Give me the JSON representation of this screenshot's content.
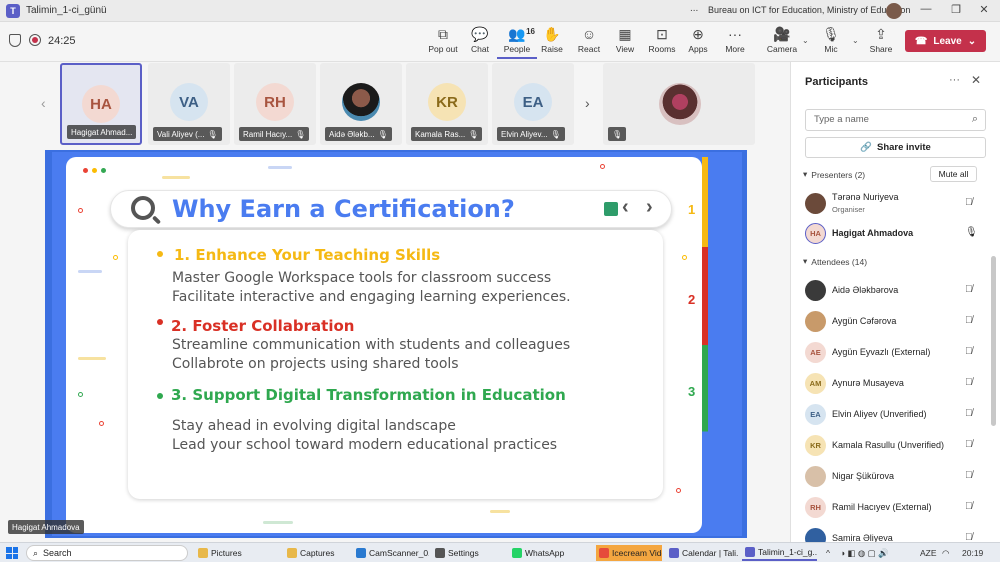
{
  "window": {
    "title": "Talimin_1-ci_günü",
    "more": "...",
    "org": "Bureau on ICT for Education, Ministry of Education",
    "controls": [
      "—",
      "❐",
      "✕"
    ]
  },
  "toolbar": {
    "timer": "24:25",
    "buttons": [
      {
        "label": "Pop out",
        "icon": "⧉"
      },
      {
        "label": "Chat",
        "icon": "💬"
      },
      {
        "label": "People",
        "icon": "👥",
        "count": "16"
      },
      {
        "label": "Raise",
        "icon": "✋"
      },
      {
        "label": "React",
        "icon": "☺"
      },
      {
        "label": "View",
        "icon": "▦"
      },
      {
        "label": "Rooms",
        "icon": "⊡"
      },
      {
        "label": "Apps",
        "icon": "⊕"
      },
      {
        "label": "More",
        "icon": "···"
      },
      {
        "label": "Camera",
        "icon": "🎥"
      },
      {
        "label": "Mic",
        "icon": "🎙"
      },
      {
        "label": "Share",
        "icon": "⇪"
      }
    ],
    "leave_label": "Leave",
    "leave_icon": "☎"
  },
  "tiles": [
    {
      "initials": "HA",
      "name": "Hagigat Ahmad...",
      "bg": "#f3d9d2",
      "fg": "#a8543f"
    },
    {
      "initials": "VA",
      "name": "Vali Aliyev (...",
      "bg": "#d6e4f0",
      "fg": "#3d5f85"
    },
    {
      "initials": "RH",
      "name": "Ramil Hacıy...",
      "bg": "#f3d9d2",
      "fg": "#a8543f"
    },
    {
      "initials": "",
      "name": "Aidə Ələkb...",
      "bg": "",
      "fg": ""
    },
    {
      "initials": "KR",
      "name": "Kamala Ras...",
      "bg": "#f6e3b4",
      "fg": "#8a6a1a"
    },
    {
      "initials": "EA",
      "name": "Elvin Aliyev...",
      "bg": "#d6e4f0",
      "fg": "#3d5f85"
    }
  ],
  "slide": {
    "title": "Why Earn a Certification?",
    "sections": [
      {
        "heading": "1. Enhance Your Teaching Skills",
        "color": "#f5b914",
        "lines": [
          "Master Google Workspace tools for classroom success",
          "Facilitate interactive and engaging learning experiences."
        ]
      },
      {
        "heading": "2. Foster Collabration",
        "color": "#d93025",
        "lines": [
          "Streamline communication with students and colleagues",
          "Collabrote on projects using shared tools"
        ]
      },
      {
        "heading": "3. Support Digital Transformation in Education",
        "color": "#2fa84f",
        "lines": [
          "Stay ahead in evolving digital landscape",
          "Lead your school toward modern educational practices"
        ]
      }
    ],
    "side_numbers": [
      "1",
      "2",
      "3"
    ],
    "speaker_name": "Hagigat Ahmadova"
  },
  "participants": {
    "title": "Participants",
    "search_placeholder": "Type a name",
    "share_invite": "Share invite",
    "presenters_label": "Presenters (2)",
    "mute_all": "Mute all",
    "attendees_label": "Attendees (14)",
    "presenters": [
      {
        "name": "Tərənə Nuriyeva",
        "role": "Organiser",
        "initials": "",
        "bg": "#6b4a3a",
        "fg": "#fff",
        "mic": "off"
      },
      {
        "name": "Hagigat Ahmadova",
        "role": "",
        "initials": "HA",
        "bg": "#f3d9d2",
        "fg": "#a8543f",
        "mic": "on"
      }
    ],
    "attendees": [
      {
        "name": "Aidə Ələkbərova",
        "initials": "",
        "bg": "#3a3a3a",
        "fg": "#fff"
      },
      {
        "name": "Aygün Cəfərova",
        "initials": "",
        "bg": "#c89a6a",
        "fg": "#fff"
      },
      {
        "name": "Aygün Eyvazlı (External)",
        "initials": "AE",
        "bg": "#f3d9d2",
        "fg": "#a8543f"
      },
      {
        "name": "Aynurə Musayeva",
        "initials": "AM",
        "bg": "#f6e3b4",
        "fg": "#8a6a1a"
      },
      {
        "name": "Elvin Aliyev (Unverified)",
        "initials": "EA",
        "bg": "#d6e4f0",
        "fg": "#3d5f85"
      },
      {
        "name": "Kamala Rasullu (Unverified)",
        "initials": "KR",
        "bg": "#f6e3b4",
        "fg": "#8a6a1a"
      },
      {
        "name": "Nigar Şükürova",
        "initials": "",
        "bg": "#d8c0a8",
        "fg": "#fff"
      },
      {
        "name": "Ramil Hacıyev (External)",
        "initials": "RH",
        "bg": "#f3d9d2",
        "fg": "#a8543f"
      },
      {
        "name": "Samira Əliyeva",
        "initials": "",
        "bg": "#3060a0",
        "fg": "#fff"
      }
    ]
  },
  "taskbar": {
    "search": "Search",
    "apps": [
      {
        "label": "Pictures",
        "color": "#e8b84a"
      },
      {
        "label": "Captures",
        "color": "#e8b84a"
      },
      {
        "label": "CamScanner_0...",
        "color": "#2a7ad0"
      },
      {
        "label": "Settings",
        "color": "#555"
      },
      {
        "label": "WhatsApp",
        "color": "#25d366"
      },
      {
        "label": "Icecream Vide...",
        "color": "#e64b3b"
      },
      {
        "label": "Calendar | Tali...",
        "color": "#5b5fc7"
      },
      {
        "label": "Talimin_1-ci_g...",
        "color": "#5b5fc7"
      }
    ],
    "lang": "AZE",
    "time": "20:19"
  }
}
